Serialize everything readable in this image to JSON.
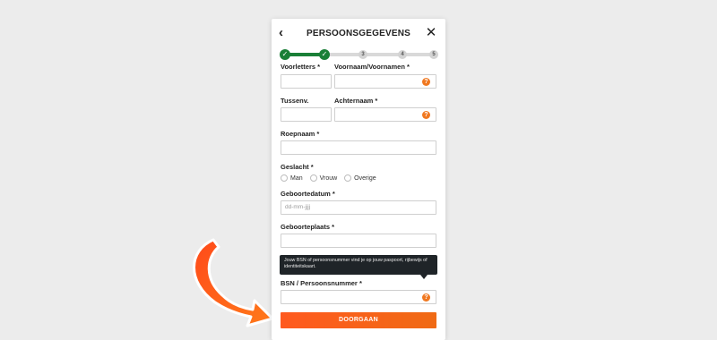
{
  "header": {
    "back_glyph": "‹",
    "title": "PERSOONSGEGEVENS",
    "close_glyph": "✕"
  },
  "progress": {
    "steps": [
      {
        "label": "✓",
        "state": "done"
      },
      {
        "label": "✓",
        "state": "done"
      },
      {
        "label": "3",
        "state": "todo"
      },
      {
        "label": "4",
        "state": "todo"
      },
      {
        "label": "5",
        "state": "todo"
      }
    ],
    "completed_fraction": 0.25
  },
  "form": {
    "voorletters_label": "Voorletters *",
    "voornaam_label": "Voornaam/Voornamen *",
    "tussenv_label": "Tussenv.",
    "achternaam_label": "Achternaam *",
    "roepnaam_label": "Roepnaam *",
    "geslacht_label": "Geslacht *",
    "geslacht_options": [
      "Man",
      "Vrouw",
      "Overige"
    ],
    "geboortedatum_label": "Geboortedatum *",
    "geboortedatum_placeholder": "dd-mm-jjjj",
    "geboorteplaats_label": "Geboorteplaats *",
    "bsn_tooltip": "Jouw BSN of persoonsnummer vind je op jouw paspoort, rijbewijs of identiteitskaart.",
    "bsn_label": "BSN / Persoonsnummer *",
    "help_glyph": "?",
    "submit_label": "DOORGAAN"
  },
  "colors": {
    "accent": "#f06a14",
    "success": "#1a7f37",
    "tooltip_bg": "#1f2428",
    "arrow": "#ff5a1f"
  },
  "icons": [
    "chevron-left-icon",
    "close-icon",
    "check-icon",
    "help-icon",
    "pointer-arrow-icon"
  ]
}
